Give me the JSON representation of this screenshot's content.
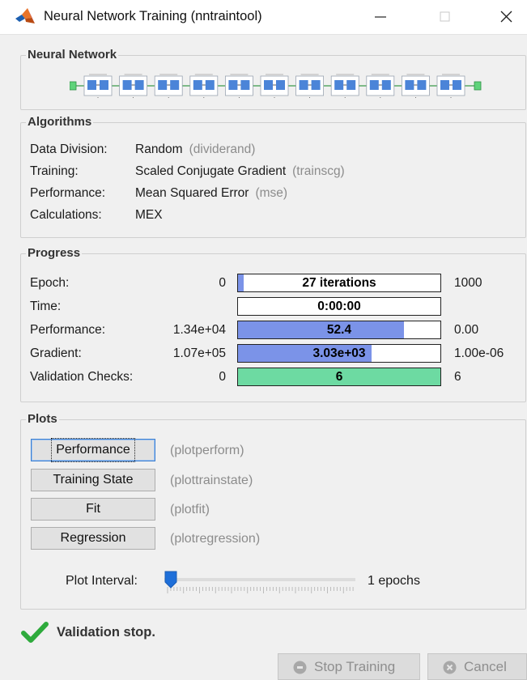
{
  "window": {
    "title": "Neural Network Training (nntraintool)"
  },
  "network": {
    "title": "Neural Network",
    "layer_count": 11
  },
  "algorithms": {
    "title": "Algorithms",
    "rows": [
      {
        "label": "Data Division:",
        "value": "Random",
        "hint": "(dividerand)"
      },
      {
        "label": "Training:",
        "value": "Scaled Conjugate Gradient",
        "hint": "(trainscg)"
      },
      {
        "label": "Performance:",
        "value": "Mean Squared Error",
        "hint": "(mse)"
      },
      {
        "label": "Calculations:",
        "value": "MEX",
        "hint": ""
      }
    ]
  },
  "progress": {
    "title": "Progress",
    "rows": [
      {
        "label": "Epoch:",
        "start": "0",
        "bar_text": "27 iterations",
        "end": "1000",
        "fill_fraction": 0.027,
        "fill_color": "blue"
      },
      {
        "label": "Time:",
        "start": "",
        "bar_text": "0:00:00",
        "end": "",
        "fill_fraction": 0,
        "fill_color": "blue"
      },
      {
        "label": "Performance:",
        "start": "1.34e+04",
        "bar_text": "52.4",
        "end": "0.00",
        "fill_fraction": 0.82,
        "fill_color": "blue"
      },
      {
        "label": "Gradient:",
        "start": "1.07e+05",
        "bar_text": "3.03e+03",
        "end": "1.00e-06",
        "fill_fraction": 0.66,
        "fill_color": "blue"
      },
      {
        "label": "Validation Checks:",
        "start": "0",
        "bar_text": "6",
        "end": "6",
        "fill_fraction": 1.0,
        "fill_color": "green"
      }
    ]
  },
  "plots": {
    "title": "Plots",
    "buttons": [
      {
        "label": "Performance",
        "hint": "(plotperform)",
        "focused": true
      },
      {
        "label": "Training State",
        "hint": "(plottrainstate)",
        "focused": false
      },
      {
        "label": "Fit",
        "hint": "(plotfit)",
        "focused": false
      },
      {
        "label": "Regression",
        "hint": "(plotregression)",
        "focused": false
      }
    ],
    "interval_label": "Plot Interval:",
    "interval_value": "1 epochs",
    "interval_fraction": 0
  },
  "status": {
    "text": "Validation stop.",
    "icon": "check-icon",
    "color": "#2eaa3c"
  },
  "buttons": {
    "stop_label": "Stop Training",
    "cancel_label": "Cancel"
  },
  "colors": {
    "bar_blue": "#7b93e8",
    "bar_green": "#6ddaa2",
    "matlab_orange": "#e8742a"
  }
}
